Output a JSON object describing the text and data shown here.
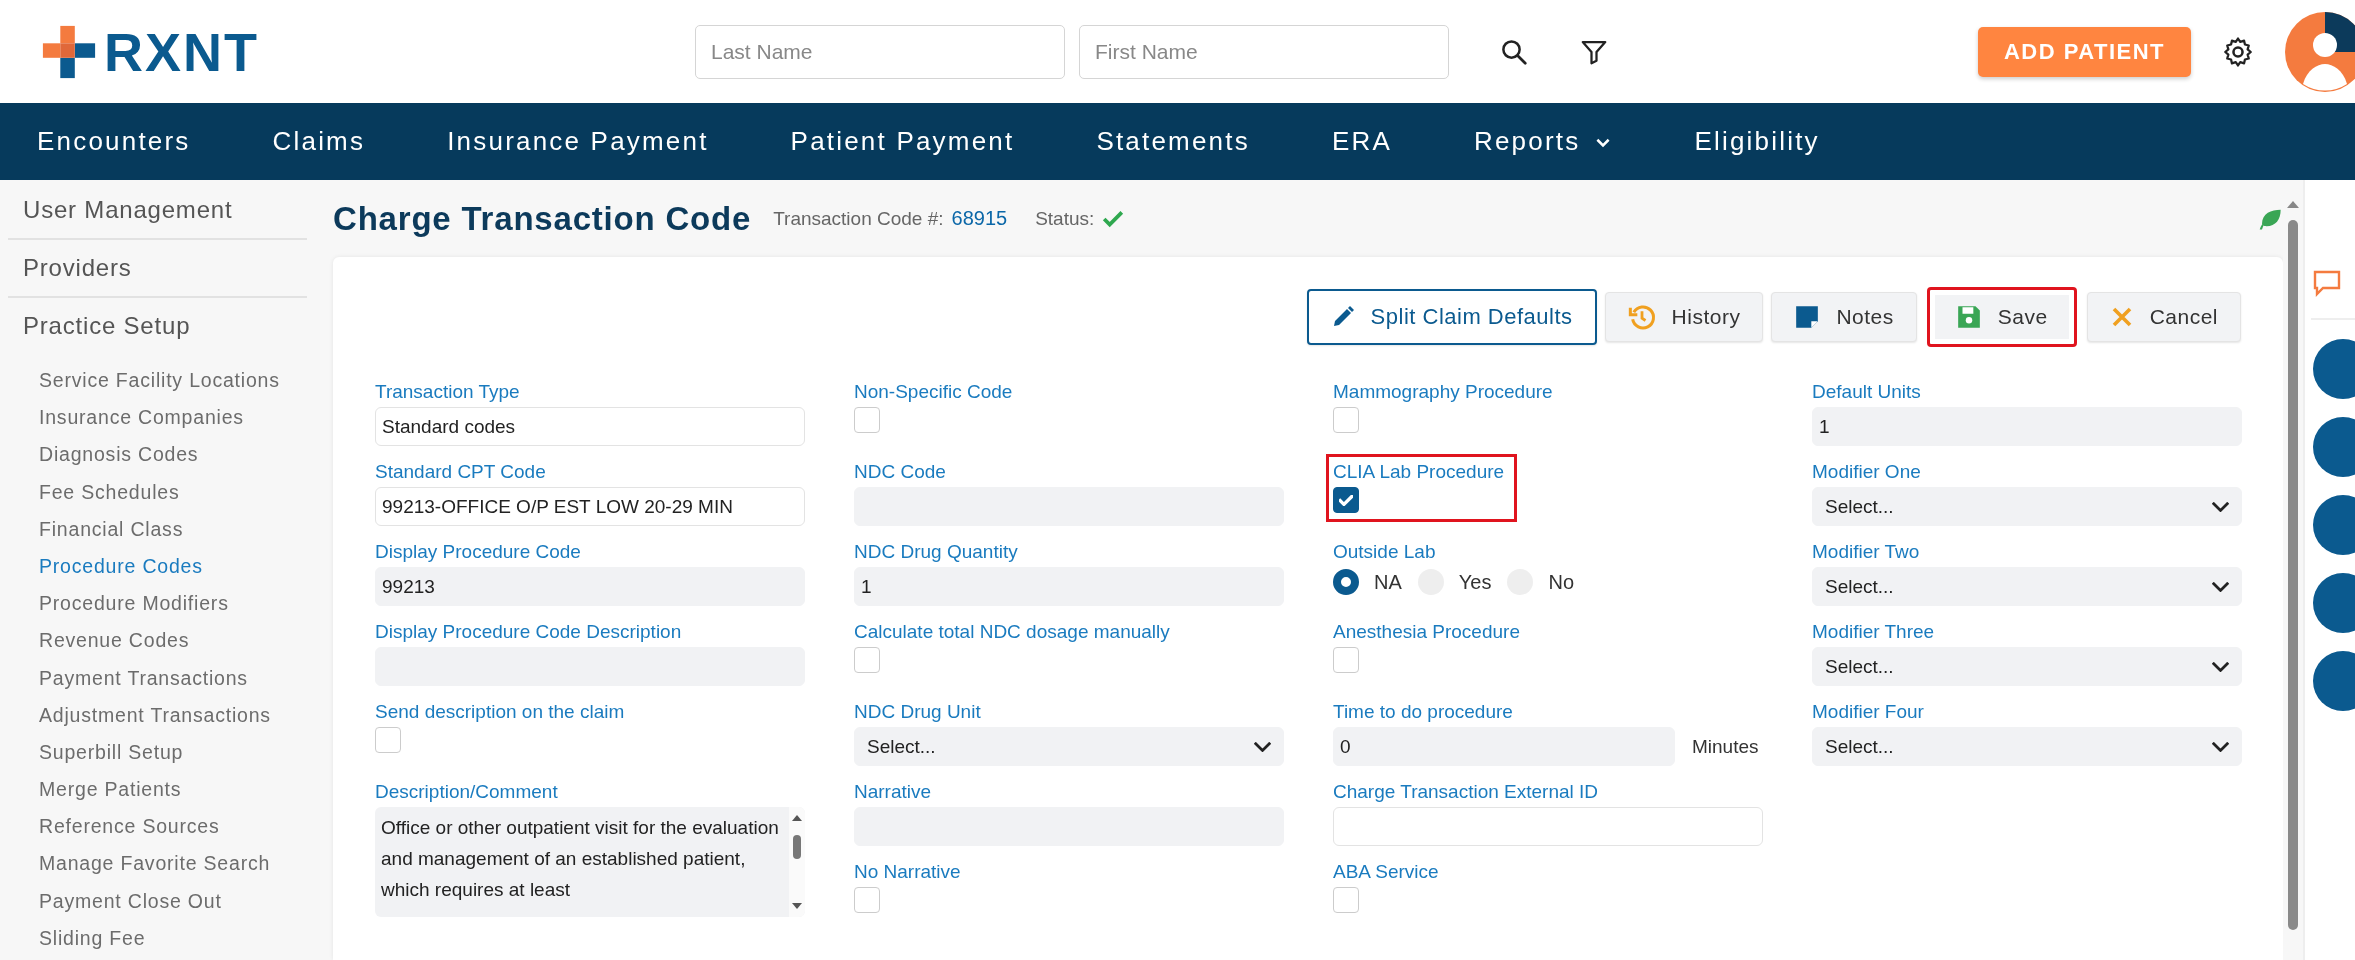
{
  "header": {
    "logo": "RXNT",
    "search_fields": [
      {
        "placeholder": "Last Name"
      },
      {
        "placeholder": "First Name"
      }
    ],
    "add_button": "ADD PATIENT"
  },
  "nav": [
    {
      "label": "Encounters",
      "dropdown": false
    },
    {
      "label": "Claims",
      "dropdown": false
    },
    {
      "label": "Insurance Payment",
      "dropdown": false
    },
    {
      "label": "Patient Payment",
      "dropdown": false
    },
    {
      "label": "Statements",
      "dropdown": false
    },
    {
      "label": "ERA",
      "dropdown": false
    },
    {
      "label": "Reports",
      "dropdown": true
    },
    {
      "label": "Eligibility",
      "dropdown": false
    }
  ],
  "sidebar": [
    {
      "label": "User Management"
    },
    {
      "label": "Providers"
    },
    {
      "label": "Practice Setup",
      "children": [
        {
          "label": "Service Facility Locations",
          "selected": false
        },
        {
          "label": "Insurance Companies",
          "selected": false
        },
        {
          "label": "Diagnosis Codes",
          "selected": false
        },
        {
          "label": "Fee Schedules",
          "selected": false
        },
        {
          "label": "Financial Class",
          "selected": false
        },
        {
          "label": "Procedure Codes",
          "selected": true
        },
        {
          "label": "Procedure Modifiers",
          "selected": false
        },
        {
          "label": "Revenue Codes",
          "selected": false
        },
        {
          "label": "Payment Transactions",
          "selected": false
        },
        {
          "label": "Adjustment Transactions",
          "selected": false
        },
        {
          "label": "Superbill Setup",
          "selected": false
        },
        {
          "label": "Merge Patients",
          "selected": false
        },
        {
          "label": "Reference Sources",
          "selected": false
        },
        {
          "label": "Manage Favorite Search",
          "selected": false
        },
        {
          "label": "Payment Close Out",
          "selected": false
        },
        {
          "label": "Sliding Fee",
          "selected": false
        }
      ]
    }
  ],
  "page": {
    "title": "Charge Transaction Code",
    "code_label": "Transaction Code #:",
    "code": "68915",
    "status_label": "Status:",
    "status_ok": true
  },
  "actions": [
    {
      "kind": "split",
      "label": "Split Claim Defaults",
      "highlighted": false
    },
    {
      "kind": "history",
      "label": "History",
      "highlighted": false
    },
    {
      "kind": "notes",
      "label": "Notes",
      "highlighted": false
    },
    {
      "kind": "save",
      "label": "Save",
      "highlighted": true
    },
    {
      "kind": "cancel",
      "label": "Cancel",
      "highlighted": false
    }
  ],
  "form_columns": [
    [
      {
        "kind": "text",
        "label": "Transaction Type",
        "value": "Standard codes",
        "editable": true
      },
      {
        "kind": "text",
        "label": "Standard CPT Code",
        "value": "99213-OFFICE O/P EST LOW 20-29 MIN",
        "editable": true
      },
      {
        "kind": "text",
        "label": "Display Procedure Code",
        "value": "99213",
        "editable": false
      },
      {
        "kind": "text",
        "label": "Display Procedure Code Description",
        "editable": false
      },
      {
        "kind": "checkbox",
        "label": "Send description on the claim",
        "checked": false,
        "highlighted": false
      },
      {
        "kind": "textarea",
        "label": "Description/Comment",
        "value": "Office or other outpatient visit for the evaluation and management of an established patient, which requires at least"
      }
    ],
    [
      {
        "kind": "checkbox",
        "label": "Non-Specific Code",
        "checked": false,
        "highlighted": false
      },
      {
        "kind": "text",
        "label": "NDC Code",
        "editable": false
      },
      {
        "kind": "text",
        "label": "NDC Drug Quantity",
        "value": "1",
        "editable": false
      },
      {
        "kind": "checkbox",
        "label": "Calculate total NDC dosage manually",
        "checked": false,
        "highlighted": false
      },
      {
        "kind": "select",
        "label": "NDC Drug Unit",
        "value": "Select..."
      },
      {
        "kind": "text",
        "label": "Narrative",
        "editable": false
      },
      {
        "kind": "checkbox",
        "label": "No Narrative",
        "checked": false,
        "highlighted": false
      }
    ],
    [
      {
        "kind": "checkbox",
        "label": "Mammography Procedure",
        "checked": false,
        "highlighted": false
      },
      {
        "kind": "checkbox",
        "label": "CLIA Lab Procedure",
        "checked": true,
        "highlighted": true
      },
      {
        "kind": "radio",
        "label": "Outside Lab",
        "options": [
          {
            "label": "NA",
            "selected": true
          },
          {
            "label": "Yes",
            "selected": false
          },
          {
            "label": "No",
            "selected": false
          }
        ]
      },
      {
        "kind": "checkbox",
        "label": "Anesthesia Procedure",
        "checked": false,
        "highlighted": false
      },
      {
        "kind": "text",
        "label": "Time to do procedure",
        "value": "0",
        "editable": false,
        "unit": "Minutes"
      },
      {
        "kind": "text",
        "label": "Charge Transaction External ID",
        "editable": true
      },
      {
        "kind": "checkbox",
        "label": "ABA Service",
        "checked": false,
        "highlighted": false
      }
    ],
    [
      {
        "kind": "text",
        "label": "Default Units",
        "value": "1",
        "editable": false
      },
      {
        "kind": "select",
        "label": "Modifier One",
        "value": "Select..."
      },
      {
        "kind": "select",
        "label": "Modifier Two",
        "value": "Select..."
      },
      {
        "kind": "select",
        "label": "Modifier Three",
        "value": "Select..."
      },
      {
        "kind": "select",
        "label": "Modifier Four",
        "value": "Select..."
      }
    ]
  ]
}
